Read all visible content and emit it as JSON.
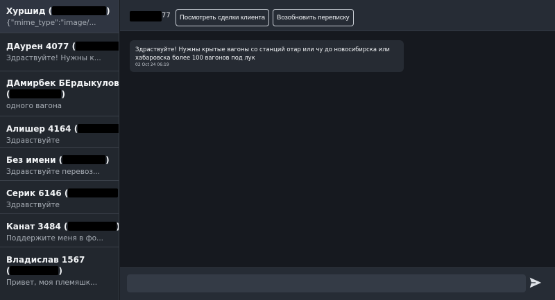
{
  "sidebar": {
    "chats": [
      {
        "name": "Хуршид (",
        "name_suffix": ")",
        "preview": "{\"mime_type\":\"image/..."
      },
      {
        "name": "ДАурен 4077 (",
        "name_suffix": ")",
        "preview": "Здраствуйте! Нужны к..."
      },
      {
        "name": "ДАмирбек БЕрдыкулов",
        "name2": "(",
        "name2_suffix": ")",
        "preview": "одного вагона"
      },
      {
        "name": "Алишер 4164 (",
        "name_suffix": ")",
        "preview": "Здравствуйте"
      },
      {
        "name": "Без имени (",
        "name_suffix": ")",
        "preview": "Здравствуйте перевоз..."
      },
      {
        "name": "Серик 6146 (",
        "name_suffix": ")",
        "preview": "Здравствуйте"
      },
      {
        "name": "Канат 3484 (",
        "name_suffix": ")",
        "preview": "Поддержите меня в фо..."
      },
      {
        "name": "Владислав 1567",
        "name2": "(",
        "name2_suffix": ")",
        "preview": "Привет, моя племяшк..."
      }
    ]
  },
  "header": {
    "contact_suffix": "77",
    "view_deals_label": "Посмотреть сделки клиента",
    "resume_label": "Возобновить переписку"
  },
  "messages": [
    {
      "text": "Здраствуйте! Нужны крытые вагоны со станций отар или чу до новосибирска или хабаровска более 100 вагонов под лук",
      "time": "02 Oct 24 06:19"
    }
  ],
  "composer": {
    "placeholder": "",
    "value": ""
  },
  "icons": {
    "send": "send-icon"
  },
  "colors": {
    "sidebar_bg": "#22272e",
    "active_chat_bg": "#2f3541",
    "main_bg": "#16191f",
    "bubble_bg": "#262b33",
    "redaction": "#000000"
  }
}
